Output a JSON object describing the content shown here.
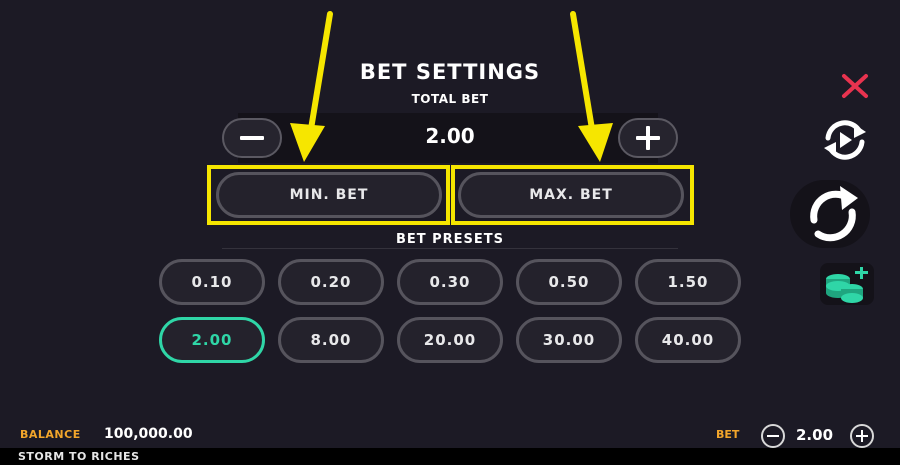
{
  "header": {
    "title": "BET SETTINGS",
    "subtitle": "TOTAL BET"
  },
  "total_bet": {
    "value": "2.00",
    "decrease_icon": "minus-icon",
    "increase_icon": "plus-icon"
  },
  "quick_bets": {
    "min_label": "MIN. BET",
    "max_label": "MAX. BET"
  },
  "presets": {
    "title": "BET PRESETS",
    "row1": [
      "0.10",
      "0.20",
      "0.30",
      "0.50",
      "1.50"
    ],
    "row2": [
      "2.00",
      "8.00",
      "20.00",
      "30.00",
      "40.00"
    ],
    "selected": "2.00"
  },
  "side_controls": {
    "close_icon": "close-icon",
    "autoplay_icon": "autoplay-icon",
    "spin_icon": "spin-icon",
    "buy_icon": "coins-plus-icon"
  },
  "footer": {
    "balance_label": "BALANCE",
    "balance_value": "100,000.00",
    "bet_label": "BET",
    "bet_value": "2.00",
    "game_name": "STORM TO RICHES"
  },
  "colors": {
    "background": "#1c1a25",
    "highlight": "#f6e600",
    "selected": "#2fd6a7",
    "label_orange": "#f2a52b",
    "close_red": "#e8334f",
    "buy_green": "#2fd6a7"
  }
}
